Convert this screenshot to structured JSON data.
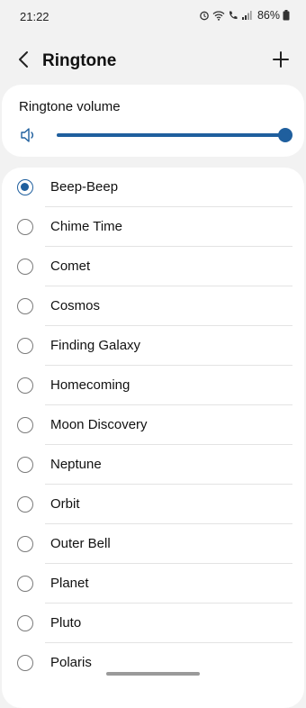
{
  "status_bar": {
    "time": "21:22",
    "battery": "86%",
    "icons": [
      "alarm-icon",
      "wifi-icon",
      "wifi-calling-icon",
      "signal-icon",
      "battery-icon"
    ]
  },
  "header": {
    "title": "Ringtone",
    "back_icon": "back-arrow-icon",
    "add_icon": "plus-icon"
  },
  "volume": {
    "label": "Ringtone volume",
    "icon": "speaker-icon",
    "level": 1.0
  },
  "ringtones": {
    "selected_index": 0,
    "items": [
      {
        "label": "Beep-Beep"
      },
      {
        "label": "Chime Time"
      },
      {
        "label": "Comet"
      },
      {
        "label": "Cosmos"
      },
      {
        "label": "Finding Galaxy"
      },
      {
        "label": "Homecoming"
      },
      {
        "label": "Moon Discovery"
      },
      {
        "label": "Neptune"
      },
      {
        "label": "Orbit"
      },
      {
        "label": "Outer Bell"
      },
      {
        "label": "Planet"
      },
      {
        "label": "Pluto"
      },
      {
        "label": "Polaris"
      }
    ]
  },
  "colors": {
    "accent": "#1f5f9e",
    "background": "#f2f2f2",
    "card": "#ffffff"
  }
}
